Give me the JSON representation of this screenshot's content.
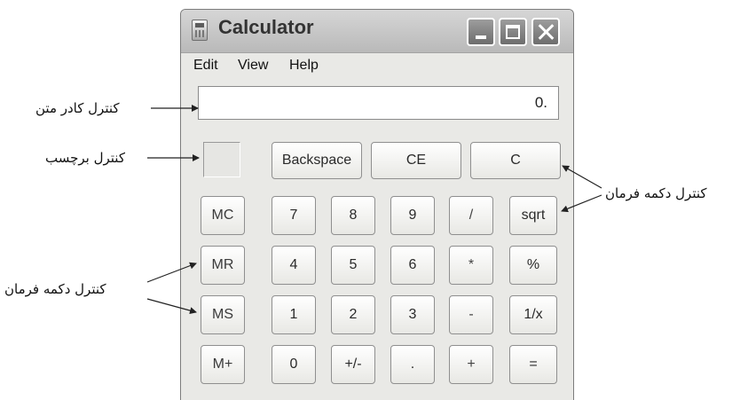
{
  "window": {
    "title": "Calculator",
    "icon": "calculator-icon",
    "controls": [
      "minimize-icon",
      "maximize-icon",
      "close-icon"
    ]
  },
  "menu": {
    "edit": "Edit",
    "view": "View",
    "help": "Help"
  },
  "display": {
    "value": "0."
  },
  "buttons": {
    "backspace": "Backspace",
    "ce": "CE",
    "c": "C",
    "mc": "MC",
    "mr": "MR",
    "ms": "MS",
    "mplus": "M+",
    "n7": "7",
    "n8": "8",
    "n9": "9",
    "n4": "4",
    "n5": "5",
    "n6": "6",
    "n1": "1",
    "n2": "2",
    "n3": "3",
    "n0": "0",
    "sign": "+/-",
    "dot": ".",
    "div": "/",
    "mul": "*",
    "sub": "-",
    "add": "+",
    "sqrt": "sqrt",
    "pct": "%",
    "inv": "1/x",
    "eq": "="
  },
  "annotations": {
    "textbox": "کنترل کادر متن",
    "label": "کنترل برچسب",
    "command_right": "کنترل دکمه فرمان",
    "command_left": "کنترل دکمه فرمان"
  }
}
